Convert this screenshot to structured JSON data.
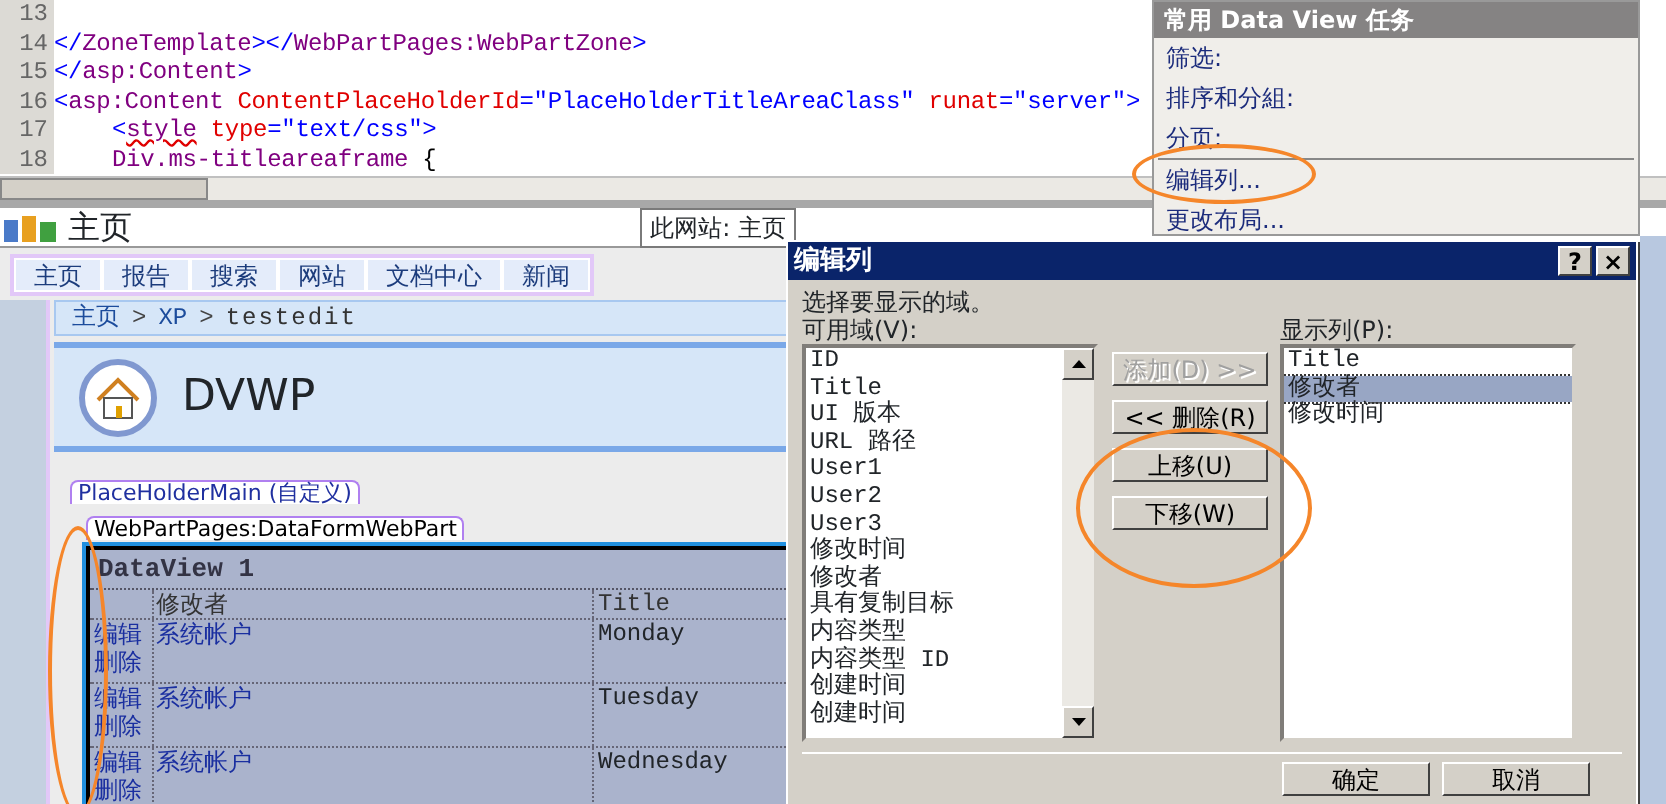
{
  "editor": {
    "lines": [
      {
        "number": "13"
      },
      {
        "number": "14",
        "indented": false,
        "tokens": [
          {
            "text": "</",
            "kind": "bracket"
          },
          {
            "text": "ZoneTemplate",
            "kind": "tag"
          },
          {
            "text": "></",
            "kind": "bracket"
          },
          {
            "text": "WebPartPages:WebPartZone",
            "kind": "tag"
          },
          {
            "text": ">",
            "kind": "bracket"
          }
        ]
      },
      {
        "number": "15",
        "indented": false,
        "tokens": [
          {
            "text": "</",
            "kind": "bracket"
          },
          {
            "text": "asp:Content",
            "kind": "tag"
          },
          {
            "text": ">",
            "kind": "bracket"
          }
        ]
      },
      {
        "number": "16",
        "indented": false,
        "tokens": [
          {
            "text": "<",
            "kind": "bracket"
          },
          {
            "text": "asp:Content",
            "kind": "tag"
          },
          {
            "text": " ContentPlaceHolderId",
            "kind": "attr"
          },
          {
            "text": "=",
            "kind": "bracket"
          },
          {
            "text": "\"PlaceHolderTitleAreaClass\"",
            "kind": "value"
          },
          {
            "text": " runat",
            "kind": "attr"
          },
          {
            "text": "=",
            "kind": "bracket"
          },
          {
            "text": "\"server\"",
            "kind": "value"
          },
          {
            "text": ">",
            "kind": "bracket"
          }
        ]
      },
      {
        "number": "17",
        "indented": true,
        "tokens": [
          {
            "text": "<",
            "kind": "bracket"
          },
          {
            "text": "style",
            "kind": "misspelled"
          },
          {
            "text": " type",
            "kind": "attr"
          },
          {
            "text": "=",
            "kind": "bracket"
          },
          {
            "text": "\"text/css\"",
            "kind": "value"
          },
          {
            "text": ">",
            "kind": "bracket"
          }
        ]
      },
      {
        "number": "18",
        "indented": true,
        "tokens": [
          {
            "text": "Div.ms-titleareaframe",
            "kind": "tag"
          },
          {
            "text": " {",
            "kind": "plain"
          }
        ]
      }
    ]
  },
  "design": {
    "site_title": "主页",
    "site_selector": "此网站: 主页",
    "nav_tabs": [
      "主页",
      "报告",
      "搜索",
      "网站",
      "文档中心",
      "新闻"
    ],
    "breadcrumb": [
      {
        "text": "主页",
        "kind": "link"
      },
      {
        "text": ">",
        "kind": "separator"
      },
      {
        "text": "XP",
        "kind": "link"
      },
      {
        "text": ">",
        "kind": "separator"
      },
      {
        "text": "testedit",
        "kind": "current"
      }
    ],
    "page_title": "DVWP",
    "placeholder_tag": "PlaceHolderMain (自定义)",
    "webpart_tag": "WebPartPages:DataFormWebPart",
    "dataview": {
      "title": "DataView 1",
      "columns": [
        "修改者",
        "Title"
      ],
      "rows": [
        {
          "actions": [
            "编辑",
            "删除"
          ],
          "cells": [
            "系统帐户",
            "Monday"
          ]
        },
        {
          "actions": [
            "编辑",
            "删除"
          ],
          "cells": [
            "系统帐户",
            "Tuesday"
          ]
        },
        {
          "actions": [
            "编辑",
            "删除"
          ],
          "cells": [
            "系统帐户",
            "Wednesday"
          ]
        }
      ]
    }
  },
  "task_panel": {
    "title": "常用 Data View 任务",
    "items": [
      {
        "text": "筛选:",
        "kind": "item"
      },
      {
        "text": "排序和分組:",
        "kind": "item"
      },
      {
        "text": "分页:",
        "kind": "item"
      },
      {
        "kind": "separator"
      },
      {
        "text": "编辑列...",
        "kind": "item"
      },
      {
        "text": "更改布局...",
        "kind": "item"
      }
    ]
  },
  "dialog": {
    "title": "编辑列",
    "help": "?",
    "close": "×",
    "instruction": "选择要显示的域。",
    "available": {
      "label": "可用域(V):",
      "items": [
        "ID",
        "Title",
        "UI 版本",
        "URL 路径",
        "User1",
        "User2",
        "User3",
        "修改时间",
        "修改者",
        "具有复制目标",
        "内容类型",
        "内容类型 ID",
        "创建时间",
        "创建时间"
      ]
    },
    "actions": [
      {
        "label": "添加(D) >>",
        "disabled": true
      },
      {
        "label": "<< 删除(R)",
        "disabled": false
      },
      {
        "label": "上移(U)",
        "disabled": false
      },
      {
        "label": "下移(W)",
        "disabled": false
      }
    ],
    "displayed": {
      "label": "显示列(P):",
      "items": [
        {
          "text": "Title",
          "selected": false
        },
        {
          "text": "修改者",
          "selected": true
        },
        {
          "text": "修改时间",
          "selected": false
        }
      ]
    },
    "buttons": [
      "确定",
      "取消"
    ]
  }
}
